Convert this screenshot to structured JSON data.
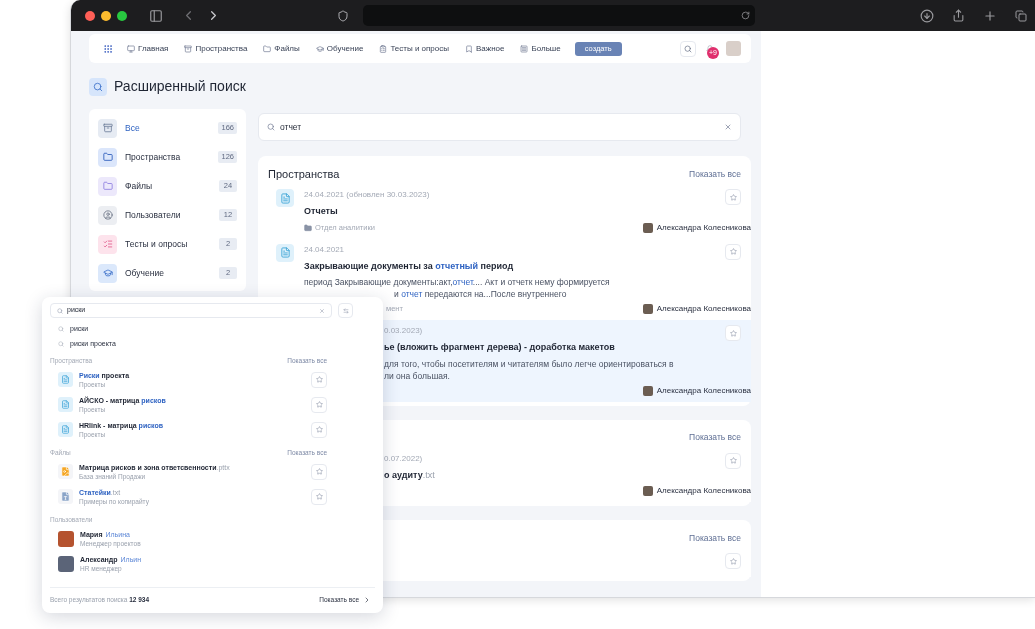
{
  "nav": {
    "items": [
      "Главная",
      "Пространства",
      "Файлы",
      "Обучение",
      "Тесты и опросы",
      "Важное",
      "Больше"
    ],
    "create_button": "создать",
    "notification_badge": "+9"
  },
  "page_title": "Расширенный поиск",
  "categories": [
    {
      "label": "Все",
      "count": "166",
      "selected": true
    },
    {
      "label": "Пространства",
      "count": "126",
      "selected": false
    },
    {
      "label": "Файлы",
      "count": "24",
      "selected": false
    },
    {
      "label": "Пользователи",
      "count": "12",
      "selected": false
    },
    {
      "label": "Тесты и опросы",
      "count": "2",
      "selected": false
    },
    {
      "label": "Обучение",
      "count": "2",
      "selected": false
    }
  ],
  "search": {
    "value": "отчет"
  },
  "sections": [
    {
      "title": "Пространства",
      "show_all": "Показать все",
      "results": [
        {
          "clipped": false,
          "highlighted": false,
          "date": "24.04.2021 (обновлен 30.03.2023)",
          "title_parts": [
            {
              "text": "Отчеты",
              "match": false
            }
          ],
          "location": {
            "text": "Отдел аналитики",
            "clipped": false
          },
          "author": "Александра Колесникова"
        },
        {
          "clipped": false,
          "highlighted": false,
          "date": "24.04.2021",
          "title_parts": [
            {
              "text": "Закрывающие документы за ",
              "match": false
            },
            {
              "text": "отчетный",
              "match": true
            },
            {
              "text": " период",
              "match": false
            }
          ],
          "snippet_lines": [
            {
              "clipped": false,
              "parts": [
                {
                  "text": "период Закрывающие документы:акт,",
                  "match": false
                },
                {
                  "text": "отчет",
                  "match": true
                },
                {
                  "text": ".... Акт и отчетк нему формируется",
                  "match": false
                }
              ]
            },
            {
              "clipped": true,
              "parts": [
                {
                  "text": "и ",
                  "match": false
                },
                {
                  "text": "отчет",
                  "match": true
                },
                {
                  "text": " передаются на...После внутреннего",
                  "match": false
                }
              ]
            }
          ],
          "location": {
            "text": "мент",
            "clipped": true
          },
          "author": "Александра Колесникова"
        },
        {
          "clipped": true,
          "highlighted": true,
          "date": "0.03.2023)",
          "title_parts": [
            {
              "text": "ье (вложить фрагмент дерева) - доработка макетов",
              "match": false
            }
          ],
          "snippet_lines": [
            {
              "parts": [
                {
                  "text": "для того, чтобы посетителям и читателям было легче ориентироваться в",
                  "match": false
                }
              ]
            },
            {
              "parts": [
                {
                  "text": "ли она большая.",
                  "match": false
                }
              ]
            }
          ],
          "author": "Александра Колесникова"
        }
      ]
    },
    {
      "show_all": "Показать все",
      "results": [
        {
          "clipped": true,
          "highlighted": false,
          "date": "0.07.2022)",
          "title_parts": [
            {
              "text": "о аудиту",
              "match": false
            }
          ],
          "extension": ".txt",
          "author": "Александра Колесникова"
        }
      ]
    },
    {
      "show_all": "Показать все",
      "results": [
        {
          "highlighted": false
        }
      ]
    }
  ],
  "popup": {
    "search_value": "риски",
    "suggestions": [
      "риски",
      "риски проекта"
    ],
    "groups": [
      {
        "title": "Пространства",
        "show_all": "Показать все",
        "items": [
          {
            "kind": "page",
            "title_parts": [
              {
                "text": "Риски",
                "match": true
              },
              {
                "text": " проекта",
                "match": false
              }
            ],
            "subtitle": "Проекты"
          },
          {
            "kind": "page",
            "title_parts": [
              {
                "text": "АЙСКО - матрица ",
                "match": false
              },
              {
                "text": "рисков",
                "match": true
              }
            ],
            "subtitle": "Проекты"
          },
          {
            "kind": "page",
            "title_parts": [
              {
                "text": "HRlink - матрица ",
                "match": false
              },
              {
                "text": "рисков",
                "match": true
              }
            ],
            "subtitle": "Проекты"
          }
        ]
      },
      {
        "title": "Файлы",
        "show_all": "Показать все",
        "items": [
          {
            "kind": "file",
            "color": "#f5a623",
            "title_parts": [
              {
                "text": "Матрица рисков и зона ответсвенности",
                "match": false
              }
            ],
            "extension": ".pttx",
            "subtitle": "База знаний Продажи"
          },
          {
            "kind": "file",
            "color": "#8aa4c8",
            "title_parts": [
              {
                "text": "Статейки",
                "match": true
              }
            ],
            "extension": ".txt",
            "subtitle": "Примеры по копирайту"
          }
        ]
      },
      {
        "title": "Пользователи",
        "items": [
          {
            "kind": "user",
            "title_parts": [
              {
                "text": "Мария",
                "match": false
              }
            ],
            "tag": "Ильина",
            "subtitle": "Менеджер проектов"
          },
          {
            "kind": "user",
            "title_parts": [
              {
                "text": "Александр",
                "match": false
              }
            ],
            "tag": "Ильин",
            "subtitle": "HR менеджер"
          }
        ]
      }
    ],
    "total": "Всего результатов поиска **12 934**",
    "show_all": "Показать все"
  }
}
